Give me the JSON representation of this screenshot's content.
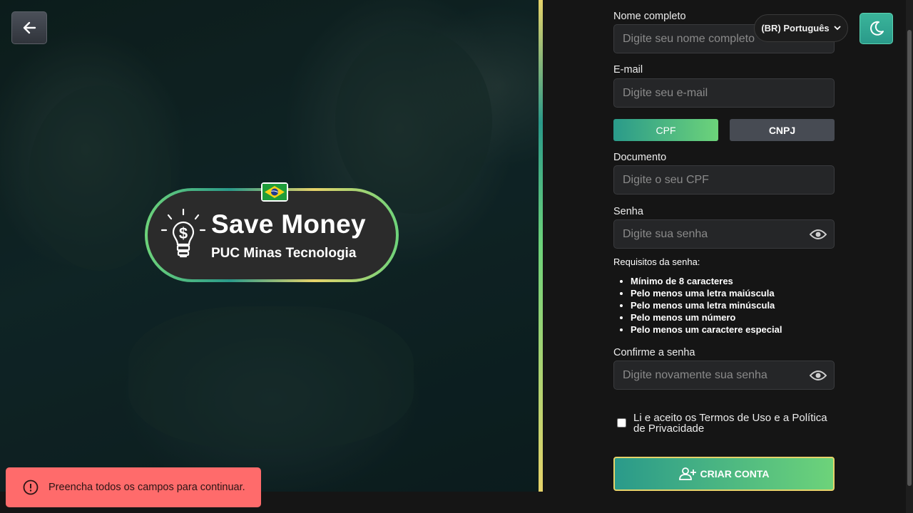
{
  "colors": {
    "accent_start": "#2a9a8a",
    "accent_end": "#6dd37a",
    "gold": "#e6d36a",
    "toast_bg": "#ff6b6b"
  },
  "header": {
    "back_icon": "arrow-left-icon",
    "language_label": "(BR) Português",
    "theme_icon": "moon-icon"
  },
  "logo": {
    "title": "Save Money",
    "subtitle": "PUC Minas Tecnologia",
    "flag_icon": "brazil-flag-icon",
    "bulb_icon": "lightbulb-dollar-icon"
  },
  "form": {
    "name": {
      "label": "Nome completo",
      "placeholder": "Digite seu nome completo"
    },
    "email": {
      "label": "E-mail",
      "placeholder": "Digite seu e-mail"
    },
    "doc_type": {
      "options": [
        "CPF",
        "CNPJ"
      ],
      "selected": "CPF"
    },
    "document": {
      "label": "Documento",
      "placeholder": "Digite o seu CPF"
    },
    "password": {
      "label": "Senha",
      "placeholder": "Digite sua senha"
    },
    "requirements": {
      "title": "Requisitos da senha:",
      "items": [
        "Mínimo de 8 caracteres",
        "Pelo menos uma letra maiúscula",
        "Pelo menos uma letra minúscula",
        "Pelo menos um número",
        "Pelo menos um caractere especial"
      ]
    },
    "confirm": {
      "label": "Confirme a senha",
      "placeholder": "Digite novamente sua senha"
    },
    "terms_label": "Li e aceito os Termos de Uso e a Política de Privacidade",
    "terms_checked": false,
    "submit_label": "CRIAR CONTA"
  },
  "toast": {
    "message": "Preencha todos os campos para continuar."
  }
}
